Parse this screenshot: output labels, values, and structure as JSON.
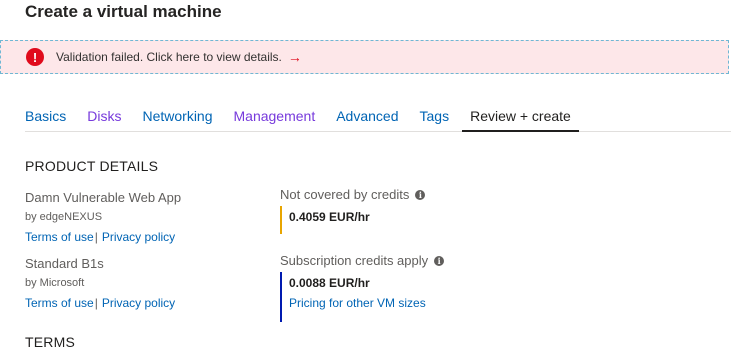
{
  "page": {
    "title": "Create a virtual machine"
  },
  "alert": {
    "icon": "error-icon",
    "message": "Validation failed. Click here to view details.",
    "arrow": "→"
  },
  "tabs": [
    {
      "label": "Basics"
    },
    {
      "label": "Disks"
    },
    {
      "label": "Networking"
    },
    {
      "label": "Management"
    },
    {
      "label": "Advanced"
    },
    {
      "label": "Tags"
    },
    {
      "label": "Review + create",
      "active": true
    }
  ],
  "product_details": {
    "heading": "PRODUCT DETAILS",
    "items": [
      {
        "name": "Damn Vulnerable Web App",
        "by": "by edgeNEXUS",
        "terms_link": "Terms of use",
        "separator": "|",
        "privacy_link": "Privacy policy",
        "credit_label": "Not covered by credits",
        "price": "0.4059 EUR/hr"
      },
      {
        "name": "Standard B1s",
        "by": "by Microsoft",
        "terms_link": "Terms of use",
        "separator": "|",
        "privacy_link": "Privacy policy",
        "credit_label": "Subscription credits apply",
        "price": "0.0088 EUR/hr",
        "pricing_link": "Pricing for other VM sizes"
      }
    ]
  },
  "terms_heading": "TERMS",
  "colors": {
    "alert_bg": "#fde7e9",
    "error_red": "#e00b1c",
    "link_blue": "#0064b4",
    "visited_purple": "#773adc",
    "bar_orange": "#e8a500",
    "bar_blue": "#001ab0"
  }
}
